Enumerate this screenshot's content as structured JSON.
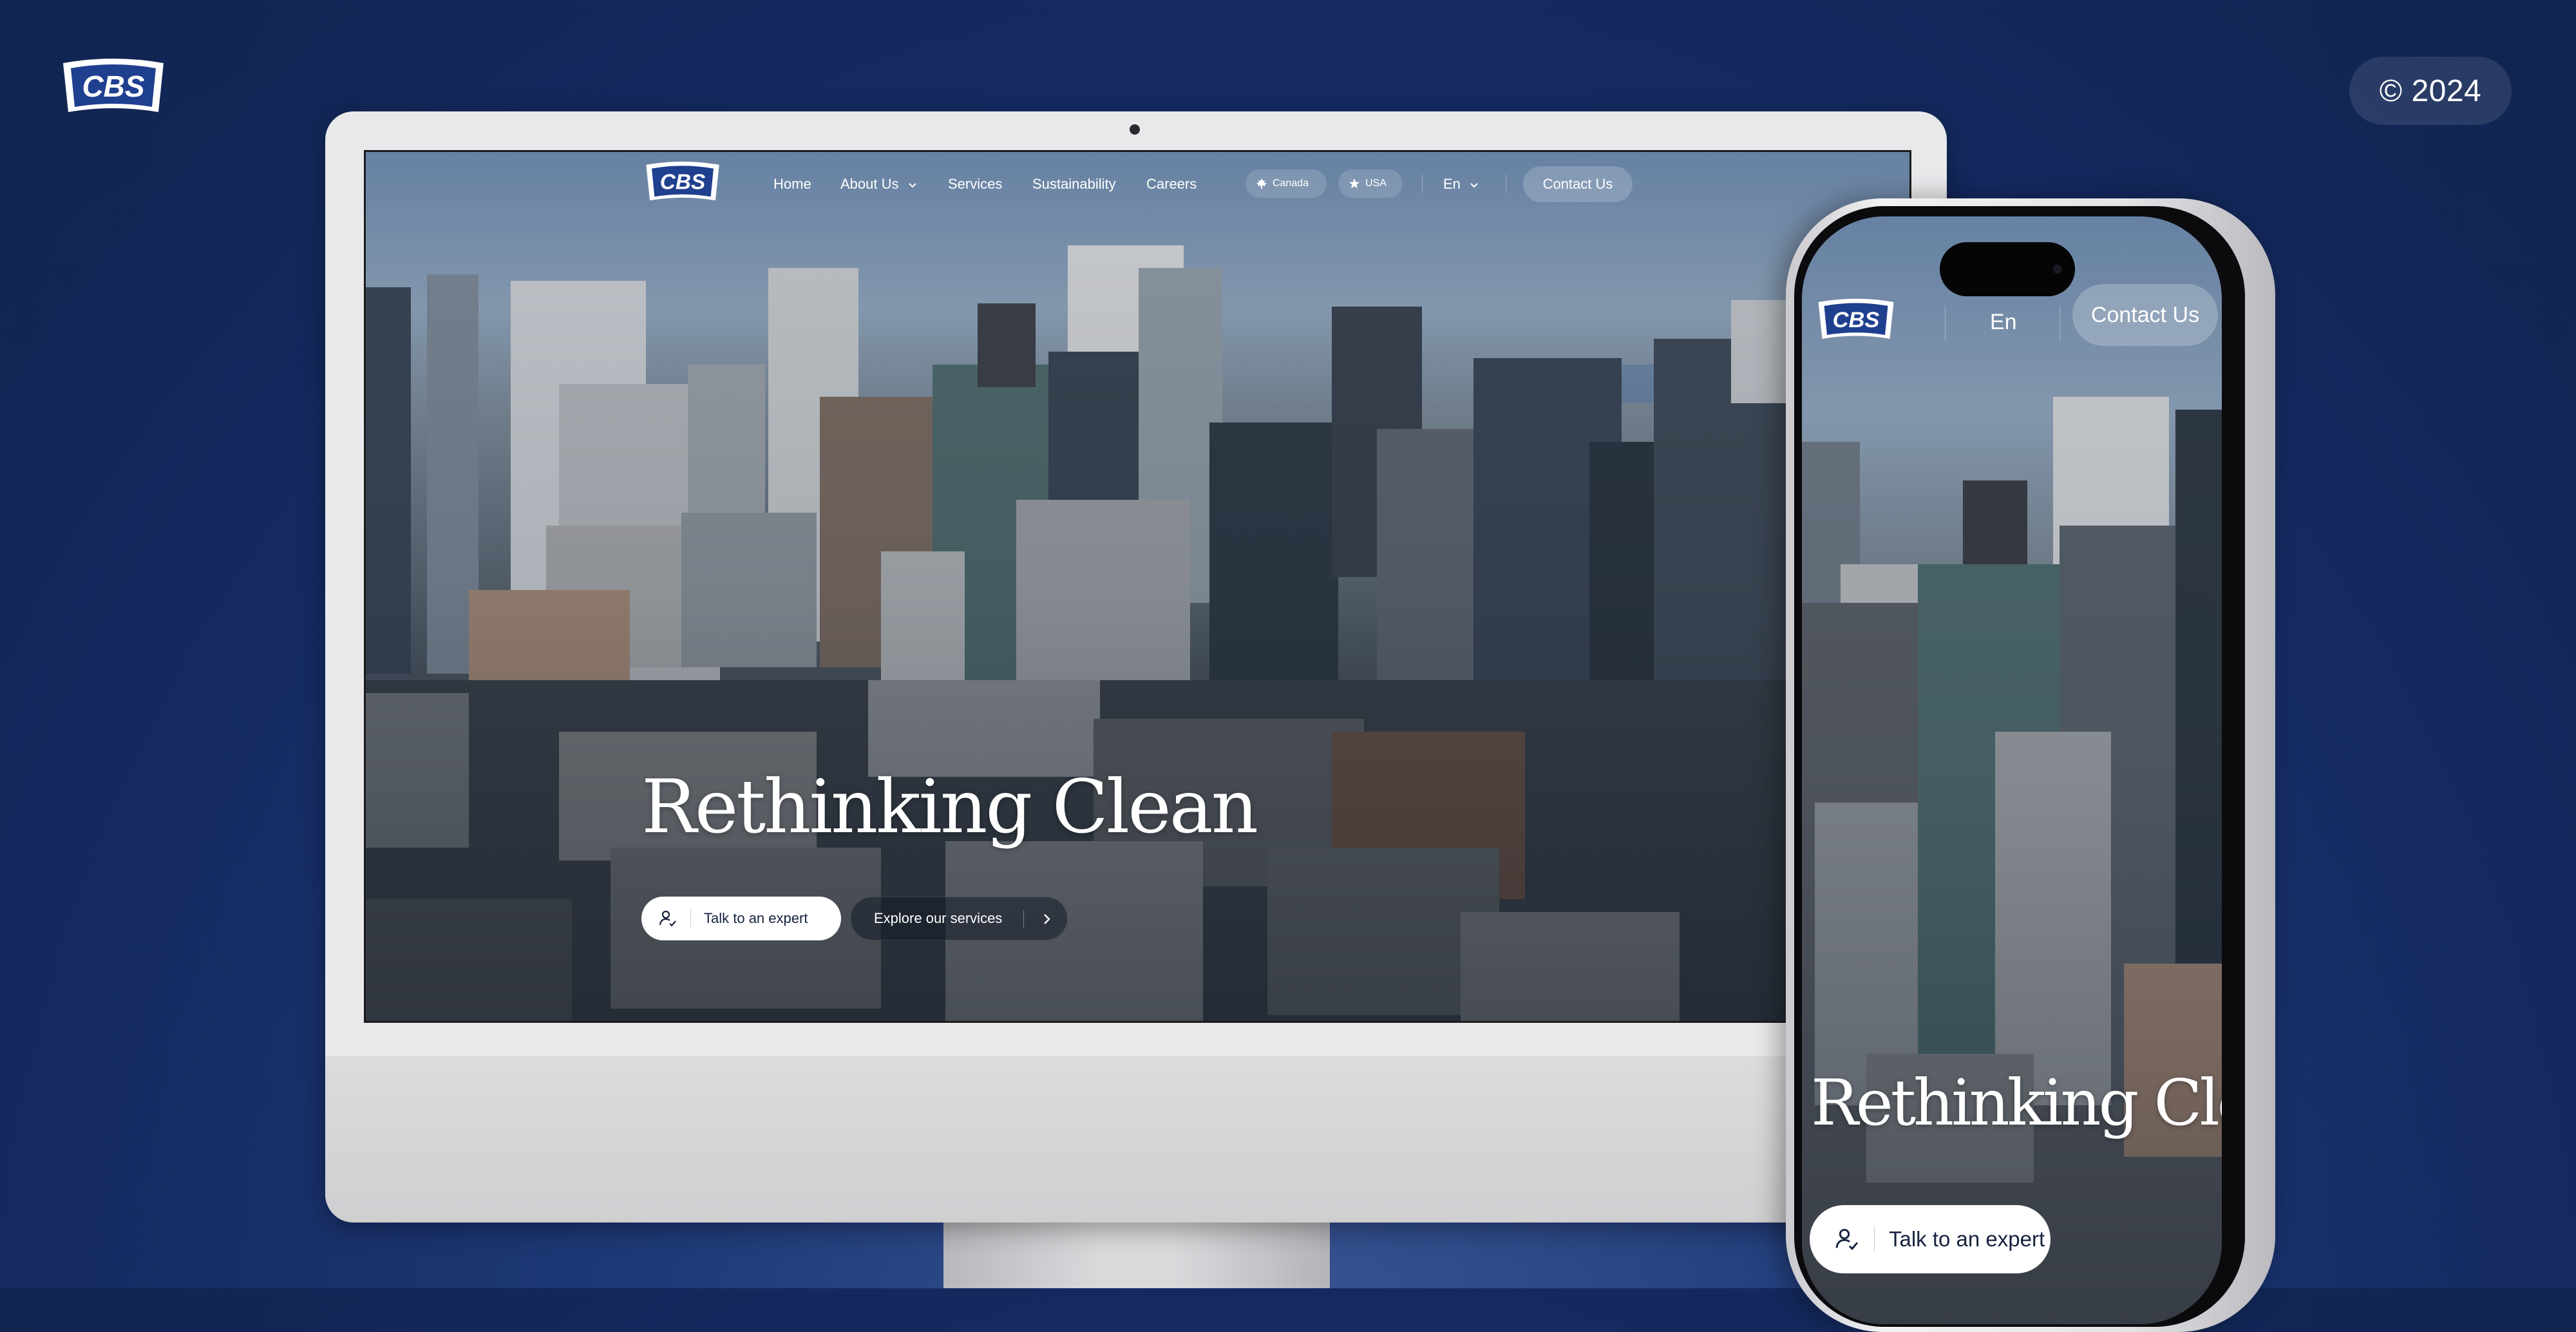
{
  "brand": {
    "logo_text": "CBS",
    "colors": {
      "navy": "#152b63",
      "logo_blue": "#1f3f8f",
      "white": "#ffffff"
    }
  },
  "copyright": "© 2024",
  "desktop": {
    "nav": {
      "items": [
        {
          "label": "Home"
        },
        {
          "label": "About Us",
          "icon": "chevron-down-icon"
        },
        {
          "label": "Services"
        },
        {
          "label": "Sustainability"
        },
        {
          "label": "Careers"
        }
      ],
      "regions": [
        {
          "label": "Canada",
          "icon": "maple-leaf-icon"
        },
        {
          "label": "USA",
          "icon": "star-icon"
        }
      ],
      "language": {
        "label": "En",
        "icon": "chevron-down-icon"
      },
      "contact_label": "Contact Us"
    },
    "hero": {
      "title": "Rethinking Clean",
      "primary_cta": {
        "label": "Talk to an expert",
        "icon": "user-check-icon"
      },
      "secondary_cta": {
        "label": "Explore our services",
        "icon": "chevron-right-icon"
      }
    }
  },
  "mobile": {
    "language_label": "En",
    "contact_label": "Contact Us",
    "hero_title": "Rethinking Clean",
    "cta": {
      "label": "Talk to an expert",
      "icon": "user-check-icon"
    }
  }
}
